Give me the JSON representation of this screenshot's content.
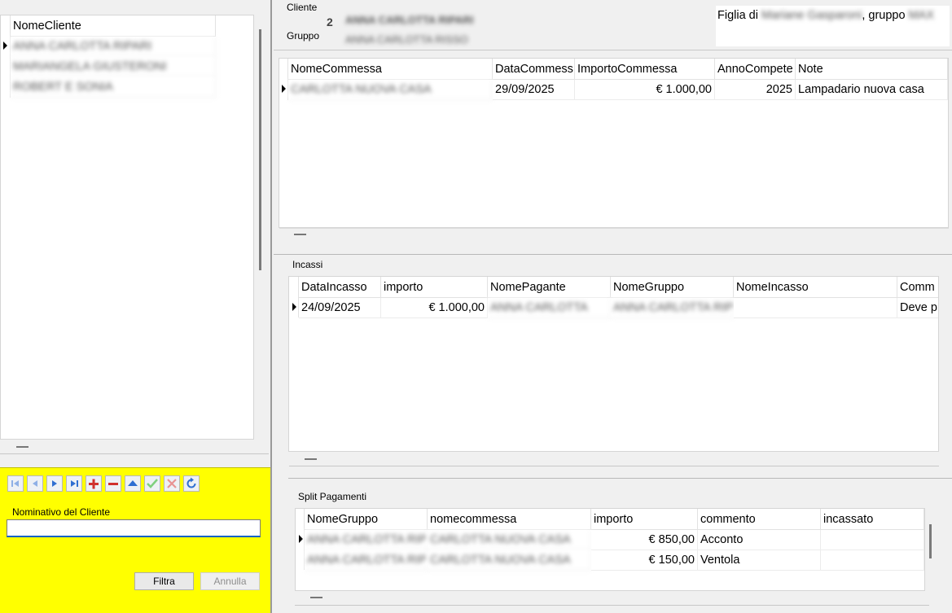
{
  "left_panel": {
    "clients_header": "NomeCliente",
    "clients": [
      {
        "name": "ANNA CARLOTTA RIPARI"
      },
      {
        "name": "MARIANGELA GIUSTERONI"
      },
      {
        "name": "ROBERT E SONIA"
      }
    ],
    "filter_label": "Nominativo del Cliente",
    "filter_value": "",
    "filter_button": "Filtra",
    "cancel_button": "Annulla",
    "nav_icons": [
      "first-icon",
      "prev-icon",
      "next-icon",
      "last-icon",
      "add-icon",
      "delete-icon",
      "up-icon",
      "confirm-icon",
      "cancel-icon",
      "refresh-icon"
    ]
  },
  "client_info": {
    "cliente_label": "Cliente",
    "gruppo_label": "Gruppo",
    "group_number": "2",
    "client_name": "ANNA CARLOTTA RIPARI",
    "group_name": "ANNA CARLOTTA RISSO",
    "note_prefix": "Figlia di",
    "note_person": "Mariane Gasparoni",
    "note_middle": ", gruppo",
    "note_group": "MAX"
  },
  "commesse": {
    "headers": [
      "NomeCommessa",
      "DataCommess",
      "ImportoCommessa",
      "AnnoCompete",
      "Note"
    ],
    "rows": [
      {
        "nome": "CARLOTTA NUOVA CASA",
        "data": "29/09/2025",
        "importo": "€ 1.000,00",
        "anno": "2025",
        "note": "Lampadario nuova casa"
      }
    ]
  },
  "incassi": {
    "title": "Incassi",
    "headers": [
      "DataIncasso",
      "importo",
      "NomePagante",
      "NomeGruppo",
      "NomeIncasso",
      "Comm"
    ],
    "rows": [
      {
        "data": "24/09/2025",
        "importo": "€ 1.000,00",
        "pagante": "ANNA CARLOTTA",
        "gruppo": "ANNA CARLOTTA RIPI",
        "incasso": "",
        "commento": "Deve p"
      }
    ]
  },
  "split": {
    "title": "Split Pagamenti",
    "headers": [
      "NomeGruppo",
      "nomecommessa",
      "importo",
      "commento",
      "incassato"
    ],
    "rows": [
      {
        "gruppo": "ANNA CARLOTTA RIPI",
        "commessa": "CARLOTTA NUOVA CASA",
        "importo": "€ 850,00",
        "commento": "Acconto",
        "incassato": ""
      },
      {
        "gruppo": "ANNA CARLOTTA RIPI",
        "commessa": "CARLOTTA NUOVA CASA",
        "importo": "€ 150,00",
        "commento": "Ventola",
        "incassato": ""
      }
    ]
  },
  "colors": {
    "filter_panel_bg": "#ffff00",
    "nav_blue": "#2f6fd1",
    "add_red": "#d0312d",
    "confirm_green": "#7fd07f"
  }
}
